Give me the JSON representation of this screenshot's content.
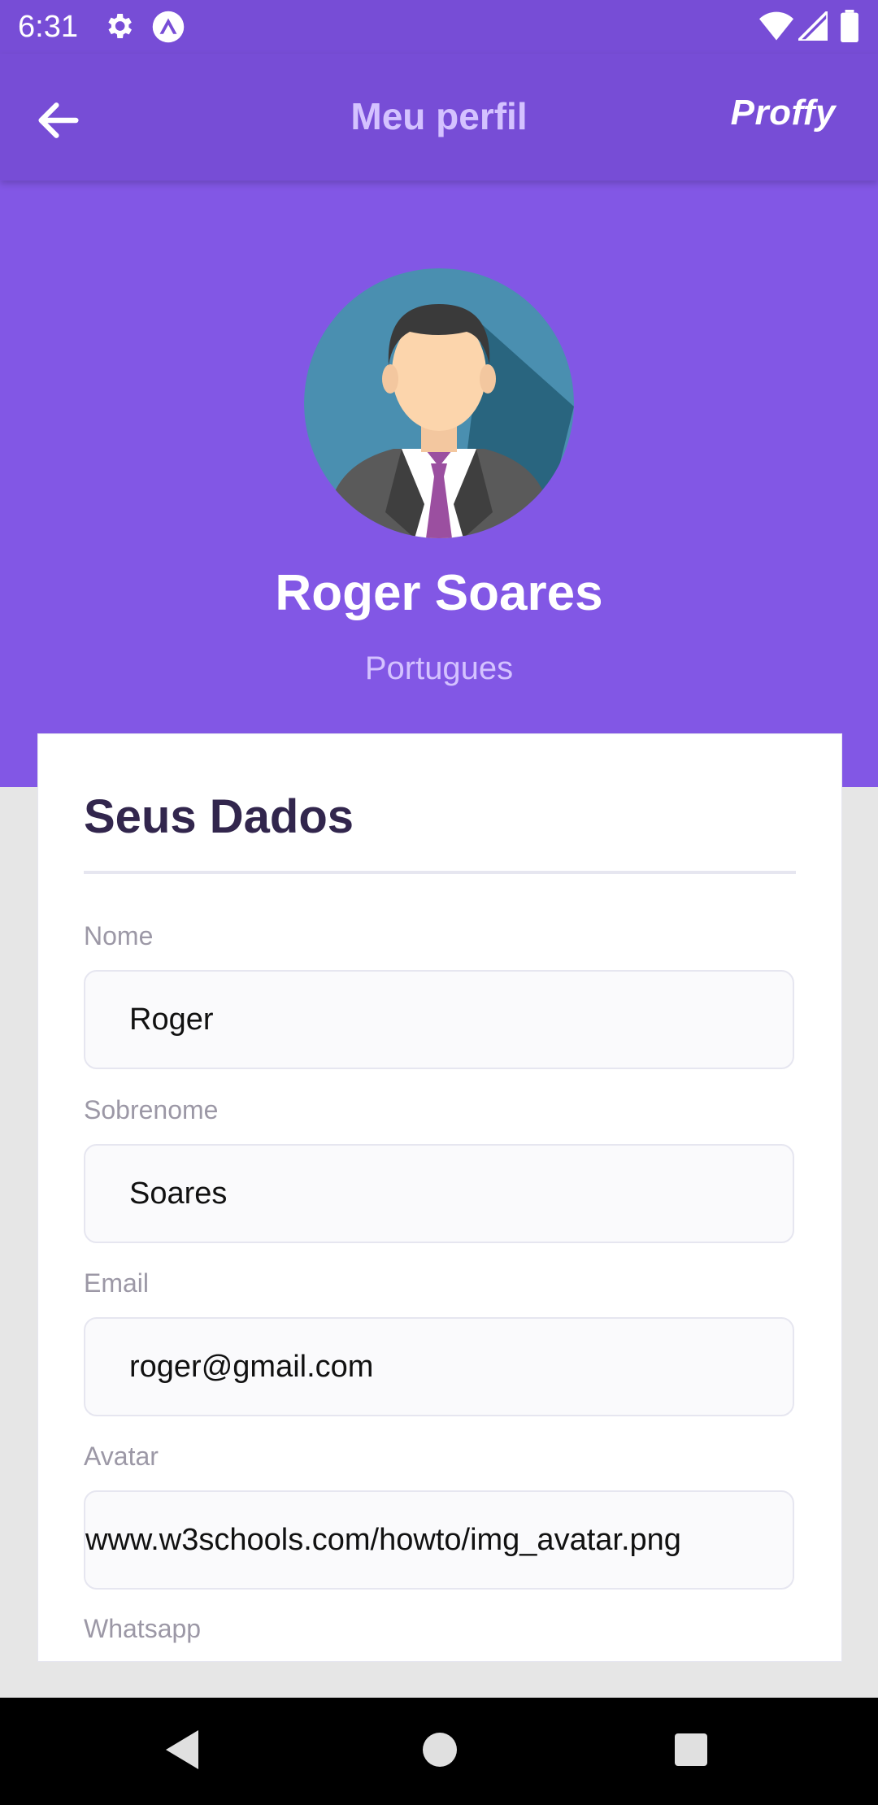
{
  "status_bar": {
    "time": "6:31",
    "icons": [
      "settings-gear-icon",
      "expo-app-icon",
      "wifi-icon",
      "signal-icon",
      "battery-icon"
    ]
  },
  "header": {
    "title": "Meu perfil",
    "brand": "Proffy",
    "back_icon": "arrow-left-icon"
  },
  "profile": {
    "name": "Roger Soares",
    "subject": "Portugues",
    "avatar_icon": "avatar-businessman-icon"
  },
  "card": {
    "title": "Seus Dados",
    "fields": [
      {
        "label": "Nome",
        "value": "Roger"
      },
      {
        "label": "Sobrenome",
        "value": "Soares"
      },
      {
        "label": "Email",
        "value": "roger@gmail.com"
      },
      {
        "label": "Avatar",
        "value": "www.w3schools.com/howto/img_avatar.png"
      },
      {
        "label": "Whatsapp",
        "value": ""
      }
    ]
  },
  "nav_bar": {
    "buttons": [
      "back-triangle-icon",
      "home-circle-icon",
      "recents-square-icon"
    ]
  },
  "colors": {
    "header": "#774dd6",
    "hero": "#8257e5",
    "title_text": "#32264d",
    "label_text": "#9c98a6",
    "input_bg": "#fafafc",
    "input_border": "#e6e6f0"
  }
}
